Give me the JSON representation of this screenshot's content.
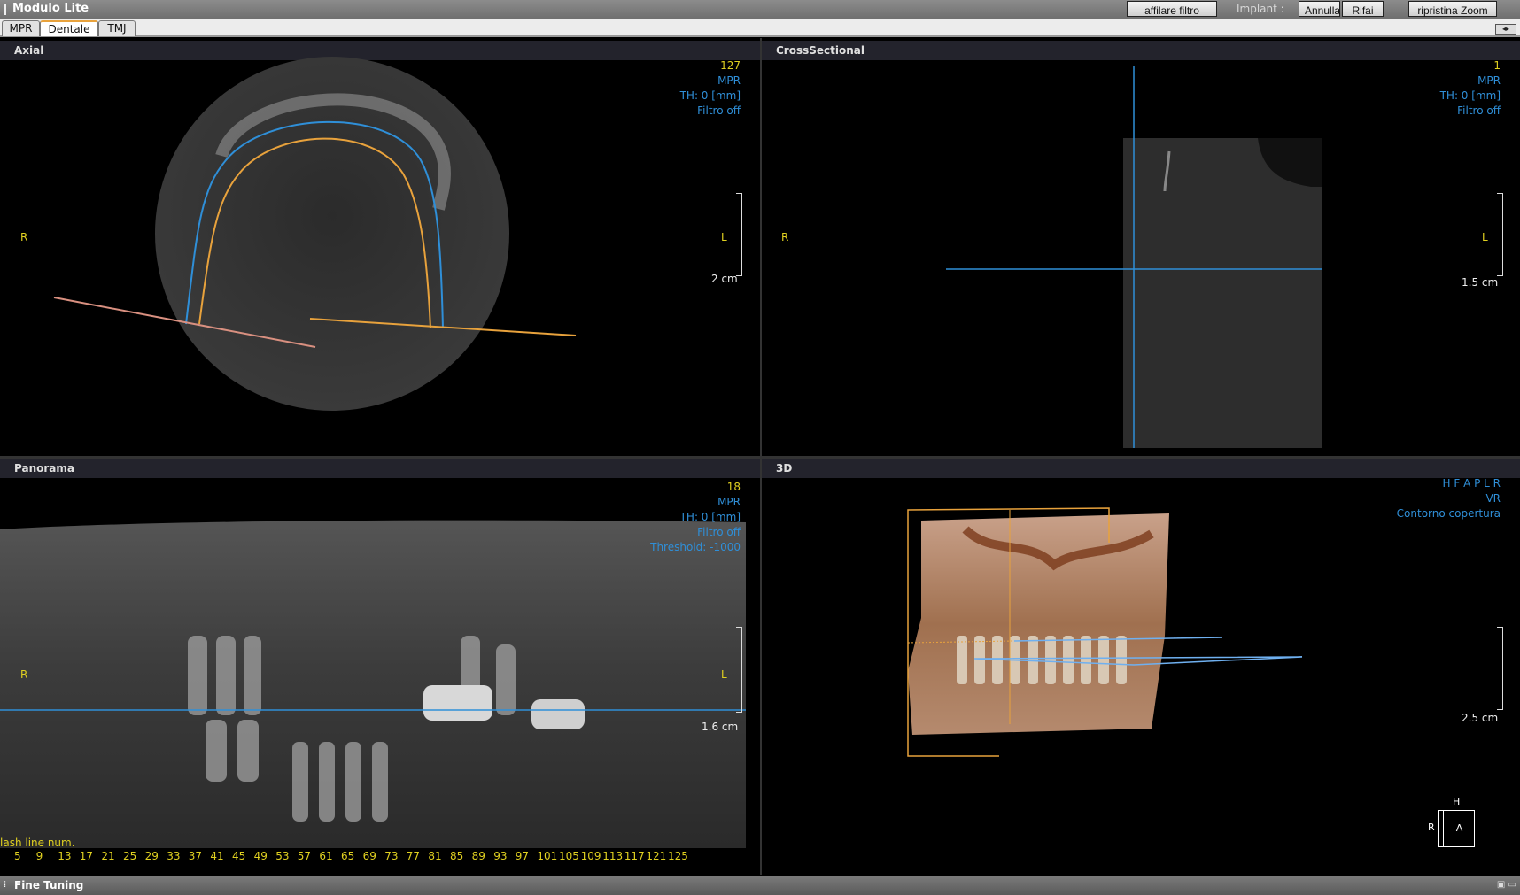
{
  "app": {
    "title": "Modulo Lite"
  },
  "toolbar": {
    "sharpen_label": "affilare filtro",
    "implant_label": "Implant :",
    "undo_label": "Annulla",
    "redo_label": "Rifai",
    "reset_zoom_label": "ripristina Zoom"
  },
  "tabs": [
    {
      "label": "MPR",
      "active": false
    },
    {
      "label": "Dentale",
      "active": true
    },
    {
      "label": "TMJ",
      "active": false
    }
  ],
  "panels": {
    "axial": {
      "title": "Axial",
      "slice": "127",
      "mode": "MPR",
      "thickness": "TH: 0 [mm]",
      "filter": "Filtro off",
      "left_label": "R",
      "right_label": "L",
      "scale": "2 cm"
    },
    "cross": {
      "title": "CrossSectional",
      "slice": "1",
      "mode": "MPR",
      "thickness": "TH: 0 [mm]",
      "filter": "Filtro off",
      "left_label": "R",
      "right_label": "L",
      "scale": "1.5 cm"
    },
    "panorama": {
      "title": "Panorama",
      "slice": "18",
      "mode": "MPR",
      "thickness": "TH: 0 [mm]",
      "filter": "Filtro off",
      "threshold": "Threshold: -1000",
      "left_label": "R",
      "right_label": "L",
      "scale": "1.6 cm",
      "slash_label": "lash line num.",
      "ticks": [
        "5",
        "9",
        "13",
        "17",
        "21",
        "25",
        "29",
        "33",
        "37",
        "41",
        "45",
        "49",
        "53",
        "57",
        "61",
        "65",
        "69",
        "73",
        "77",
        "81",
        "85",
        "89",
        "93",
        "97",
        "101",
        "105",
        "109",
        "113",
        "117",
        "121",
        "125"
      ]
    },
    "vr3d": {
      "title": "3D",
      "orientation": "H F A P L R",
      "mode": "VR",
      "overlay": "Contorno copertura",
      "scale": "2.5 cm",
      "cube_top": "H",
      "cube_left": "R",
      "cube_face": "A"
    }
  },
  "footer": {
    "label": "Fine Tuning"
  },
  "colors": {
    "info_blue": "#2f8fd8",
    "label_yellow": "#e0d020",
    "accent_orange": "#e8a23c"
  }
}
